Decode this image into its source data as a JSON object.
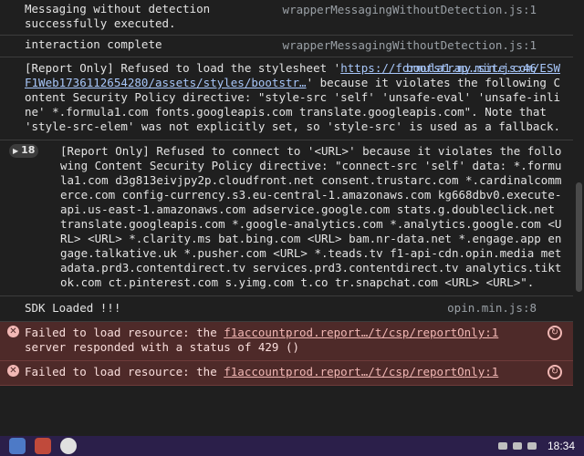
{
  "console": {
    "messages": [
      {
        "text": "Messaging without detection\nsuccessfully executed.",
        "source": "wrapperMessagingWithoutDetection.js:1"
      },
      {
        "text": "interaction complete",
        "source": "wrapperMessagingWithoutDetection.js:1"
      },
      {
        "text_prefix": "[Report Only] Refused to load the stylesheet '",
        "url": "https://formula1.my.site.com/ESWF1Web1736112654280/assets/styles/bootstr…",
        "text_suffix": "' because it violates the following Content Security Policy directive: \"style-src 'self' 'unsafe-eval' 'unsafe-inline' *.formula1.com fonts.googleapis.com translate.googleapis.com\". Note that 'style-src-elem' was not explicitly set, so 'style-src' is used as a fallback.",
        "source": "bootstrap.min.js:46"
      },
      {
        "count": "18",
        "text": "[Report Only] Refused to connect to '<URL>' because it violates the following Content Security Policy directive: \"connect-src 'self' data: *.formula1.com d3g813eivjpy2p.cloudfront.net consent.trustarc.com *.cardinalcommerce.com config-currency.s3.eu-central-1.amazonaws.com kg668dbv0.execute-api.us-east-1.amazonaws.com adservice.google.com stats.g.doubleclick.net translate.googleapis.com *.google-analytics.com *.analytics.google.com <URL> <URL> *.clarity.ms bat.bing.com <URL> bam.nr-data.net *.engage.app engage.talkative.uk *.pusher.com <URL> *.teads.tv f1-api-cdn.opin.media metadata.prd3.contentdirect.tv services.prd3.contentdirect.tv analytics.tiktok.com ct.pinterest.com s.yimg.com t.co tr.snapchat.com <URL> <URL>\"."
      },
      {
        "text": "SDK Loaded !!!",
        "source": "opin.min.js:8"
      },
      {
        "error": true,
        "text_prefix": "Failed to load resource: the ",
        "link": "f1accountprod.report…/t/csp/reportOnly:1",
        "text_suffix": "\nserver responded with a status of 429 ()"
      },
      {
        "error": true,
        "text_prefix": "Failed to load resource: the ",
        "link": "f1accountprod.report…/t/csp/reportOnly:1"
      }
    ]
  },
  "taskbar": {
    "clock": "18:34"
  },
  "icons": {
    "error": "error-circle-icon",
    "network": "network-retry-icon",
    "group": "expand-triangle-icon"
  }
}
